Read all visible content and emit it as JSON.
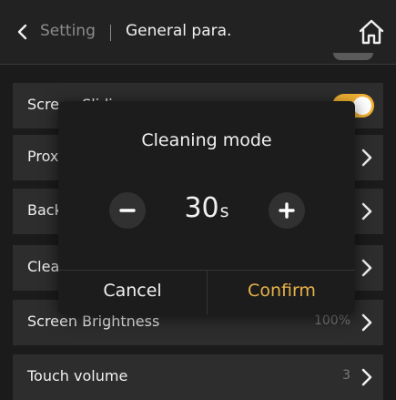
{
  "header": {
    "back_label": "Setting",
    "title": "General para."
  },
  "settings": [
    {
      "label": "Screen Sliding",
      "value": "",
      "control": "toggle",
      "toggle_on": true
    },
    {
      "label": "Proximity sense",
      "value": "",
      "control": "chevron"
    },
    {
      "label": "Background",
      "value": "",
      "control": "chevron"
    },
    {
      "label": "Cleaning mode",
      "value": "",
      "control": "chevron"
    },
    {
      "label": "Screen Brightness",
      "value": "100%",
      "control": "chevron"
    },
    {
      "label": "Touch volume",
      "value": "3",
      "control": "chevron"
    }
  ],
  "dialog": {
    "title": "Cleaning mode",
    "value": "30",
    "unit": "s",
    "cancel_label": "Cancel",
    "confirm_label": "Confirm"
  },
  "icons": {
    "back": "chevron-left-icon",
    "home": "home-icon",
    "row_arrow": "chevron-right-icon",
    "decrement": "minus-icon",
    "increment": "plus-icon"
  },
  "colors": {
    "accent": "#f2b233",
    "confirm_text": "#e8b34a",
    "background": "#1b1b1b",
    "row_background": "#2d2d2d",
    "dialog_background": "#1c1c1c",
    "muted_text": "#8c8c8c"
  }
}
